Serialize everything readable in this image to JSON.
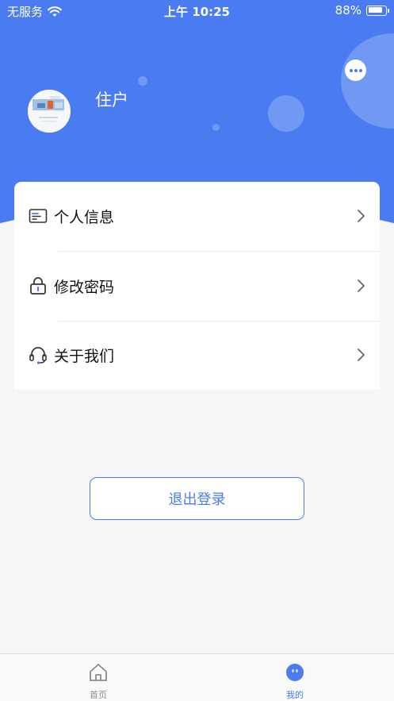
{
  "status_bar": {
    "carrier": "无服务",
    "time": "上午 10:25",
    "battery": "88%",
    "battery_level": 0.88
  },
  "profile": {
    "name": "住户",
    "avatar_icon": "avatar-image",
    "message_icon": "chat-bubble-icon"
  },
  "menu": {
    "items": [
      {
        "label": "个人信息",
        "icon": "id-card-icon"
      },
      {
        "label": "修改密码",
        "icon": "lock-icon"
      },
      {
        "label": "关于我们",
        "icon": "headset-icon"
      }
    ]
  },
  "logout": {
    "label": "退出登录"
  },
  "tabbar": {
    "tabs": [
      {
        "label": "首页",
        "icon": "home-icon",
        "active": false
      },
      {
        "label": "我的",
        "icon": "profile-face-icon",
        "active": true
      }
    ]
  },
  "colors": {
    "primary": "#4a7bf0",
    "background": "#f6f6f7",
    "text": "#111111",
    "inactive": "#8c8c8c"
  }
}
